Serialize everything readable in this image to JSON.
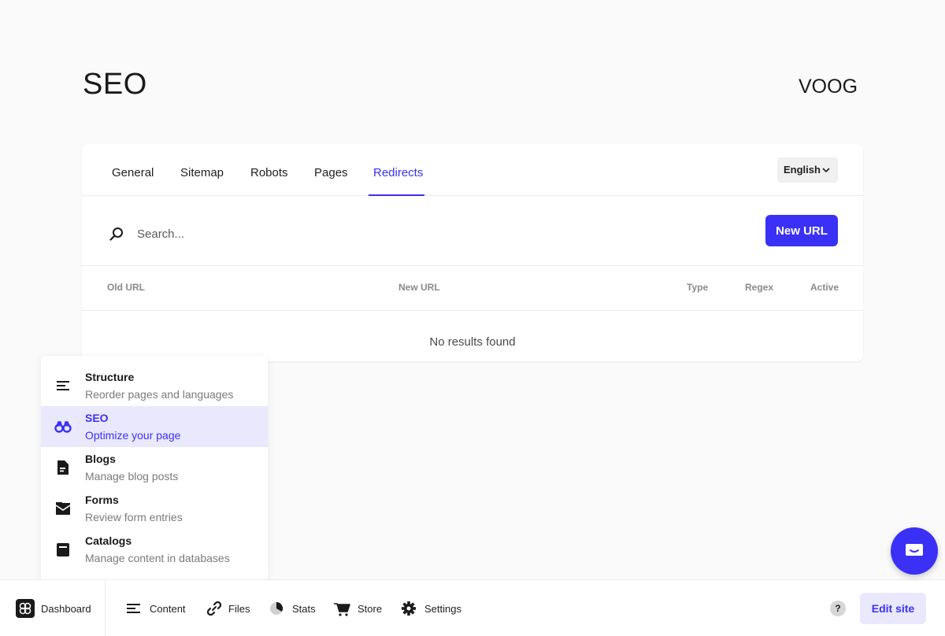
{
  "page": {
    "title": "SEO",
    "logo_text": "VOOG"
  },
  "tabs": [
    {
      "label": "General"
    },
    {
      "label": "Sitemap"
    },
    {
      "label": "Robots"
    },
    {
      "label": "Pages"
    },
    {
      "label": "Redirects",
      "active": true
    }
  ],
  "language": {
    "selected": "English"
  },
  "search": {
    "placeholder": "Search...",
    "value": ""
  },
  "new_url_button": "New URL",
  "table": {
    "columns": [
      "Old URL",
      "New URL",
      "Type",
      "Regex",
      "Active"
    ],
    "rows": [],
    "empty_text": "No results found"
  },
  "menu": {
    "items": [
      {
        "title": "Structure",
        "subtitle": "Reorder pages and languages",
        "icon": "structure-icon"
      },
      {
        "title": "SEO",
        "subtitle": "Optimize your page",
        "icon": "binoculars-icon",
        "active": true
      },
      {
        "title": "Blogs",
        "subtitle": "Manage blog posts",
        "icon": "document-icon"
      },
      {
        "title": "Forms",
        "subtitle": "Review form entries",
        "icon": "mail-icon"
      },
      {
        "title": "Catalogs",
        "subtitle": "Manage content in databases",
        "icon": "catalog-icon"
      }
    ]
  },
  "bottom_bar": {
    "dashboard": "Dashboard",
    "content": "Content",
    "files": "Files",
    "stats": "Stats",
    "store": "Store",
    "settings": "Settings",
    "help": "?",
    "edit_site": "Edit site"
  },
  "colors": {
    "accent": "#3b30f5",
    "accent_light": "#e9e8fd"
  }
}
